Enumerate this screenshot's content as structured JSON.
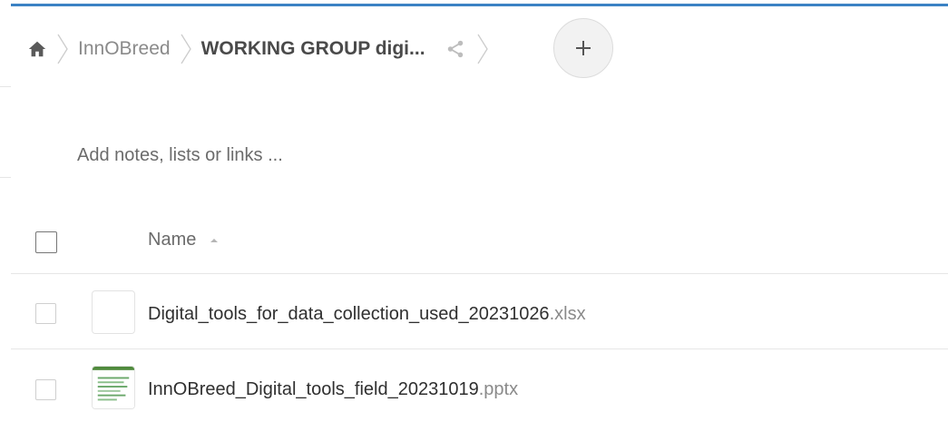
{
  "breadcrumb": {
    "home_icon": "home-icon",
    "items": [
      {
        "label": "InnOBreed"
      },
      {
        "label": "WORKING GROUP digi..."
      }
    ],
    "share_icon": "share-icon"
  },
  "add_button": {
    "icon": "plus-icon",
    "label": "+"
  },
  "notes": {
    "placeholder": "Add notes, lists or links ..."
  },
  "table": {
    "header": {
      "name_label": "Name",
      "sort": "ascending"
    },
    "rows": [
      {
        "basename": "Digital_tools_for_data_collection_used_20231026",
        "extension": ".xlsx",
        "thumbnail": "blank-document-thumbnail"
      },
      {
        "basename": "InnOBreed_Digital_tools_field_20231019",
        "extension": ".pptx",
        "thumbnail": "presentation-thumbnail"
      }
    ]
  },
  "colors": {
    "accent": "#3b82c4",
    "text_primary": "#2f2f2f",
    "text_muted": "#8a8a8a",
    "divider": "#e6e6e6"
  }
}
